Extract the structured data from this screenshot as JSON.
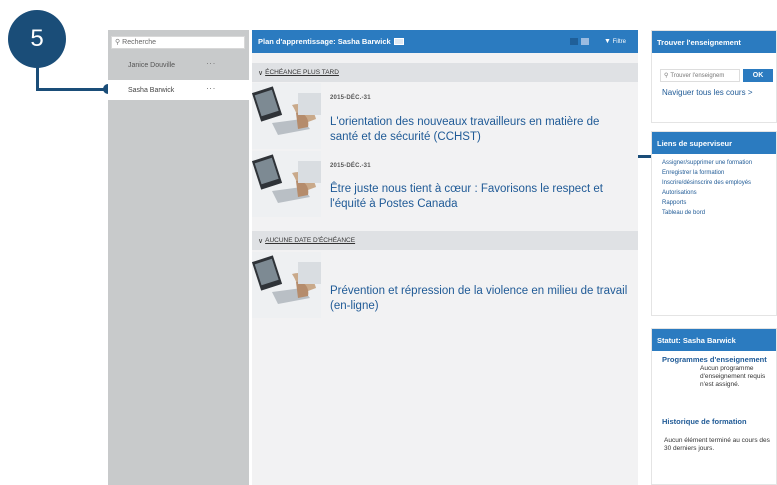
{
  "step": "5",
  "sidebar": {
    "search_placeholder": "Recherche",
    "employees": [
      {
        "name": "Janice Douville"
      },
      {
        "name": "Sasha Barwick"
      }
    ]
  },
  "main": {
    "header_title": "Plan d'apprentissage: Sasha Barwick",
    "filter_label": "Filtre",
    "sections": [
      {
        "label": "ÉCHÉANCE PLUS TARD"
      },
      {
        "label": "AUCUNE DATE D'ÉCHÉANCE"
      }
    ],
    "courses": [
      {
        "date": "2015-DÉC.-31",
        "title": "L'orientation des nouveaux travailleurs en matière de santé et de sécurité (CCHST)"
      },
      {
        "date": "2015-DÉC.-31",
        "title": "Être juste nous tient à cœur : Favorisons le respect et l'équité à Postes Canada"
      },
      {
        "date": "",
        "title": "Prévention et répression de la violence en milieu de travail (en-ligne)"
      }
    ]
  },
  "find": {
    "title": "Trouver l'enseignement",
    "input_placeholder": "Trouver l'enseignem",
    "ok_label": "OK",
    "browse_label": "Naviguer tous les cours",
    "browse_arrow": ">"
  },
  "supervisor": {
    "title": "Liens de superviseur",
    "links": [
      "Assigner/supprimer une formation",
      "Enregistrer la formation",
      "Inscrire/désinscrire des employés",
      "Autorisations",
      "Rapports",
      "Tableau de bord"
    ]
  },
  "status": {
    "title": "Statut: Sasha Barwick",
    "programs_label": "Programmes d'enseignement",
    "programs_note": "Aucun programme d'enseignement requis n'est assigné.",
    "history_label": "Historique de formation",
    "history_note": "Aucun élément terminé au cours des 30 derniers jours."
  },
  "colors": {
    "accent": "#2b7bc0",
    "callout": "#1a4d78",
    "link": "#1f5a96"
  }
}
